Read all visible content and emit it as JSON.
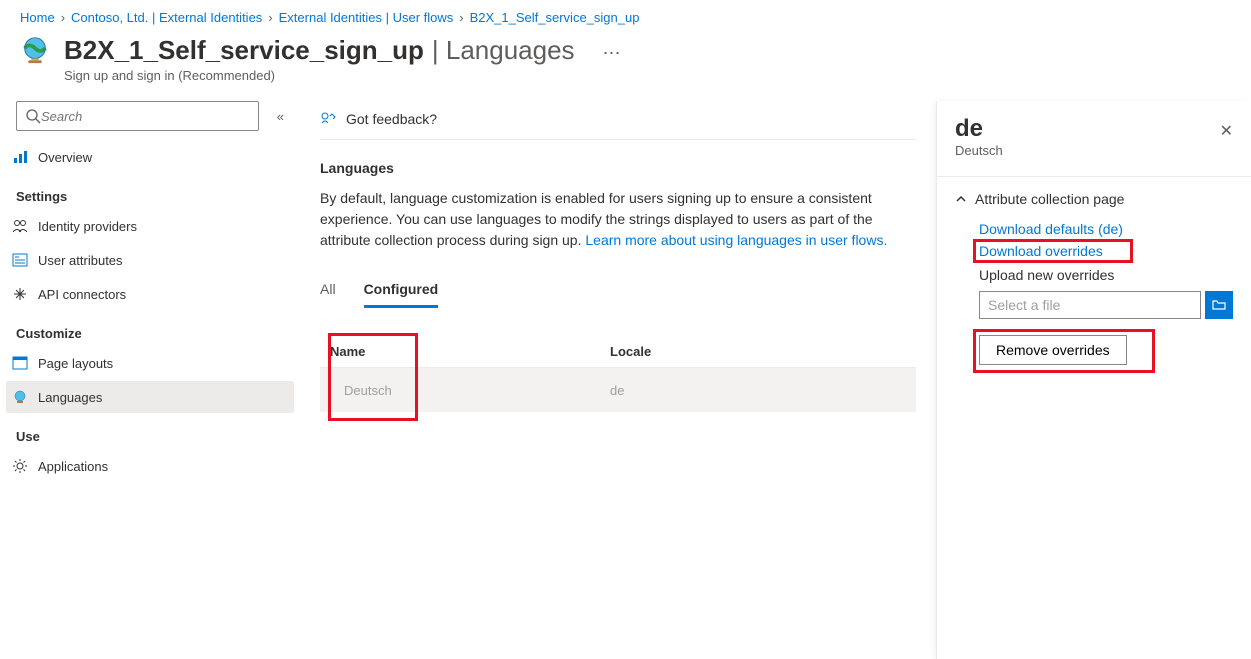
{
  "breadcrumb": [
    {
      "label": "Home"
    },
    {
      "label": "Contoso, Ltd. | External Identities"
    },
    {
      "label": "External Identities | User flows"
    },
    {
      "label": "B2X_1_Self_service_sign_up"
    }
  ],
  "header": {
    "title_main": "B2X_1_Self_service_sign_up",
    "title_sub": "| Languages",
    "subtitle": "Sign up and sign in (Recommended)"
  },
  "sidebar": {
    "search_placeholder": "Search",
    "overview": "Overview",
    "group_settings": "Settings",
    "items_settings": [
      "Identity providers",
      "User attributes",
      "API connectors"
    ],
    "group_customize": "Customize",
    "items_customize": [
      "Page layouts",
      "Languages"
    ],
    "group_use": "Use",
    "items_use": [
      "Applications"
    ]
  },
  "main": {
    "feedback": "Got feedback?",
    "section_title": "Languages",
    "desc_text": "By default, language customization is enabled for users signing up to ensure a consistent experience. You can use languages to modify the strings displayed to users as part of the attribute collection process during sign up. ",
    "desc_link": "Learn more about using languages in user flows.",
    "tabs": {
      "all": "All",
      "configured": "Configured"
    },
    "table": {
      "th_name": "Name",
      "th_locale": "Locale",
      "rows": [
        {
          "name": "Deutsch",
          "locale": "de"
        }
      ]
    }
  },
  "panel": {
    "title": "de",
    "subtitle": "Deutsch",
    "section": "Attribute collection page",
    "dl_defaults": "Download defaults (de)",
    "dl_overrides": "Download overrides",
    "upload_label": "Upload new overrides",
    "select_file": "Select a file",
    "remove": "Remove overrides"
  }
}
